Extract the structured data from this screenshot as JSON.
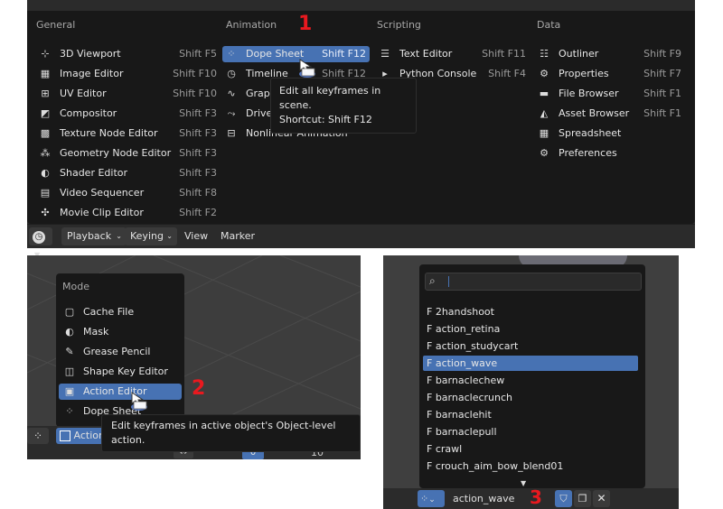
{
  "panel1": {
    "columns": [
      {
        "header": "General",
        "items": [
          {
            "icon": "3d-viewport-icon",
            "glyph": "⊹",
            "label": "3D Viewport",
            "shortcut": "Shift F5"
          },
          {
            "icon": "image-editor-icon",
            "glyph": "▦",
            "label": "Image Editor",
            "shortcut": "Shift F10"
          },
          {
            "icon": "uv-editor-icon",
            "glyph": "⊞",
            "label": "UV Editor",
            "shortcut": "Shift F10"
          },
          {
            "icon": "compositor-icon",
            "glyph": "◩",
            "label": "Compositor",
            "shortcut": "Shift F3"
          },
          {
            "icon": "texture-node-icon",
            "glyph": "▩",
            "label": "Texture Node Editor",
            "shortcut": "Shift F3"
          },
          {
            "icon": "geometry-node-icon",
            "glyph": "⁂",
            "label": "Geometry Node Editor",
            "shortcut": "Shift F3"
          },
          {
            "icon": "shader-editor-icon",
            "glyph": "◐",
            "label": "Shader Editor",
            "shortcut": "Shift F3"
          },
          {
            "icon": "video-sequencer-icon",
            "glyph": "▤",
            "label": "Video Sequencer",
            "shortcut": "Shift F8"
          },
          {
            "icon": "movie-clip-icon",
            "glyph": "✣",
            "label": "Movie Clip Editor",
            "shortcut": "Shift F2"
          }
        ]
      },
      {
        "header": "Animation",
        "items": [
          {
            "icon": "dope-sheet-icon",
            "glyph": "⁘",
            "label": "Dope Sheet",
            "shortcut": "Shift F12"
          },
          {
            "icon": "timeline-icon",
            "glyph": "◷",
            "label": "Timeline",
            "shortcut": "Shift F12"
          },
          {
            "icon": "graph-editor-icon",
            "glyph": "∿",
            "label": "Graph Editor",
            "shortcut": ""
          },
          {
            "icon": "drivers-icon",
            "glyph": "⤳",
            "label": "Drivers",
            "shortcut": ""
          },
          {
            "icon": "nonlinear-animation-icon",
            "glyph": "⊟",
            "label": "Nonlinear Animation",
            "shortcut": ""
          }
        ]
      },
      {
        "header": "Scripting",
        "items": [
          {
            "icon": "text-editor-icon",
            "glyph": "☰",
            "label": "Text Editor",
            "shortcut": "Shift F11"
          },
          {
            "icon": "python-console-icon",
            "glyph": "▸",
            "label": "Python Console",
            "shortcut": "Shift F4"
          }
        ]
      },
      {
        "header": "Data",
        "items": [
          {
            "icon": "outliner-icon",
            "glyph": "☷",
            "label": "Outliner",
            "shortcut": "Shift F9"
          },
          {
            "icon": "properties-icon",
            "glyph": "⚙",
            "label": "Properties",
            "shortcut": "Shift F7"
          },
          {
            "icon": "file-browser-icon",
            "glyph": "▬",
            "label": "File Browser",
            "shortcut": "Shift F1"
          },
          {
            "icon": "asset-browser-icon",
            "glyph": "◭",
            "label": "Asset Browser",
            "shortcut": "Shift F1"
          },
          {
            "icon": "spreadsheet-icon",
            "glyph": "▦",
            "label": "Spreadsheet",
            "shortcut": ""
          },
          {
            "icon": "preferences-icon",
            "glyph": "⚙",
            "label": "Preferences",
            "shortcut": ""
          }
        ]
      }
    ],
    "tooltip": {
      "line1": "Edit all keyframes in scene.",
      "line2": "Shortcut: Shift F12"
    },
    "step_badge": "1",
    "header_bar": {
      "playback": "Playback",
      "keying": "Keying",
      "view": "View",
      "marker": "Marker"
    }
  },
  "panel2": {
    "menu_title": "Mode",
    "items": [
      {
        "icon": "cache-file-icon",
        "glyph": "▢",
        "label": "Cache File"
      },
      {
        "icon": "mask-icon",
        "glyph": "◐",
        "label": "Mask"
      },
      {
        "icon": "grease-pencil-icon",
        "glyph": "✎",
        "label": "Grease Pencil"
      },
      {
        "icon": "shape-key-editor-icon",
        "glyph": "◫",
        "label": "Shape Key Editor"
      },
      {
        "icon": "action-editor-icon",
        "glyph": "▣",
        "label": "Action Editor"
      },
      {
        "icon": "dope-sheet-icon",
        "glyph": "⁘",
        "label": "Dope Sheet"
      }
    ],
    "tooltip": "Edit keyframes in active object's Object-level action.",
    "step_badge": "2",
    "header_mode": "Action",
    "timeline": {
      "current_frame": "0",
      "tick": "10"
    }
  },
  "panel3": {
    "search": {
      "placeholder": "",
      "value": ""
    },
    "items": [
      "F 2handshoot",
      "F action_retina",
      "F action_studycart",
      "F action_wave",
      "F barnaclechew",
      "F barnaclecrunch",
      "F barnaclehit",
      "F barnaclepull",
      "F crawl",
      "F crouch_aim_bow_blend01"
    ],
    "selected_index": 3,
    "action_field": "action_wave",
    "step_badge": "3"
  },
  "colors": {
    "accent": "#4772b3",
    "badge": "#e8191f",
    "menu_bg": "#181818"
  }
}
